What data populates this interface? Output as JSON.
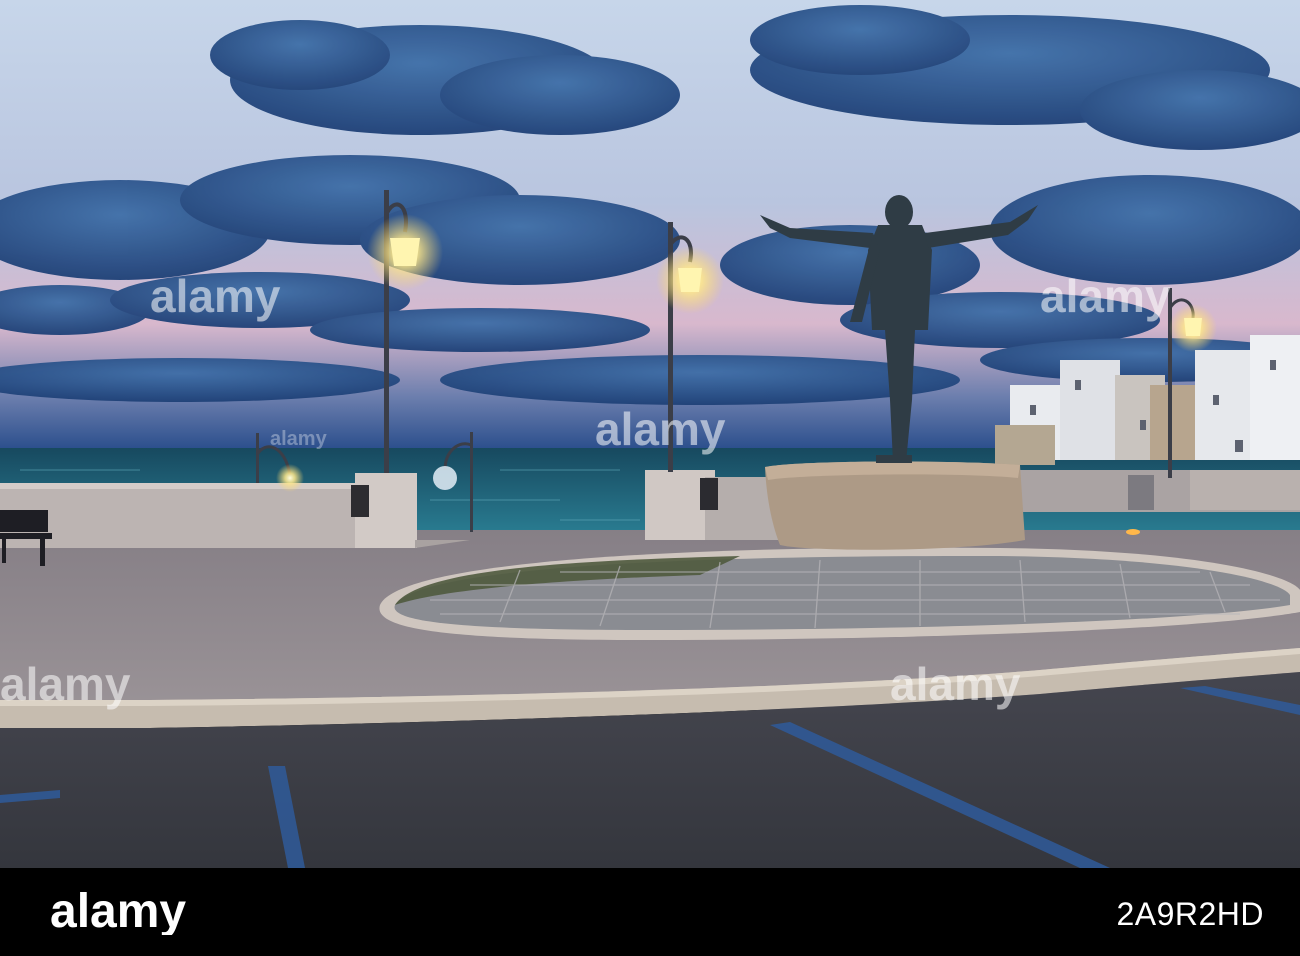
{
  "photo": {
    "scene": "Seafront promenade at dusk with a bronze statue of a man with outstretched arms",
    "colors": {
      "sky_top": "#c9d8ea",
      "sky_pink": "#e6b8c8",
      "sea": "#1f6e86",
      "pavement": "#8f8a8e",
      "road": "#3d3f47",
      "lamp_glow": "#fff6b8"
    }
  },
  "watermark": {
    "brand": "alamy",
    "repeated_text": "alamy"
  },
  "footer": {
    "logo_text": "alamy",
    "image_id": "2A9R2HD"
  }
}
